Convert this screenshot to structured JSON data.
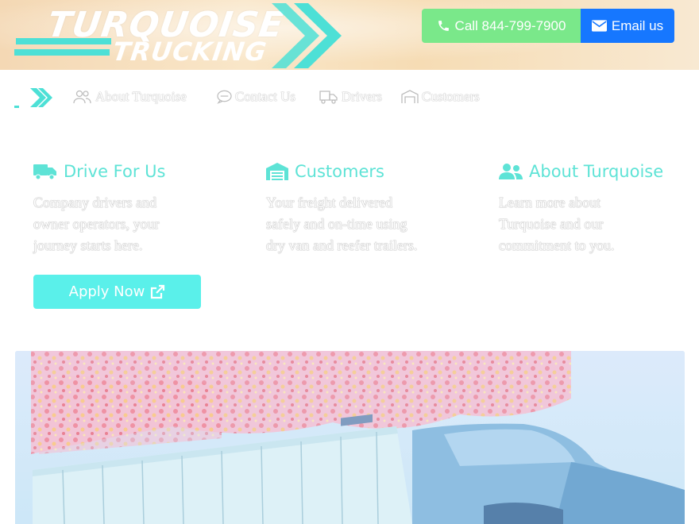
{
  "header": {
    "logo_line1": "TURQUOISE",
    "logo_line2": "TRUCKING",
    "call_label": "Call 844-799-7900",
    "email_label": "Email us",
    "colors": {
      "accent": "#4de0d6",
      "call": "#7ae88a",
      "email": "#1677ff"
    }
  },
  "nav": {
    "items": [
      {
        "label": "About Turquoise",
        "icon": "users-icon"
      },
      {
        "label": "Contact Us",
        "icon": "chat-icon"
      },
      {
        "label": "Drivers",
        "icon": "truck-icon"
      },
      {
        "label": "Customers",
        "icon": "warehouse-icon"
      }
    ]
  },
  "columns": [
    {
      "title": "Drive For Us",
      "icon": "truck-icon",
      "lines": [
        "Company drivers and",
        "owner operators, your",
        "journey starts here."
      ]
    },
    {
      "title": "Customers",
      "icon": "warehouse-icon",
      "lines": [
        "Your freight delivered",
        "safely and on-time using",
        "dry van and reefer trailers."
      ]
    },
    {
      "title": "About Turquoise",
      "icon": "users-icon",
      "lines": [
        "Learn more about",
        "Turquoise and our",
        "commitment to you."
      ]
    }
  ],
  "apply": {
    "label": "Apply Now",
    "icon": "external-link-icon"
  },
  "hero": {
    "icon": "truck-photo"
  }
}
